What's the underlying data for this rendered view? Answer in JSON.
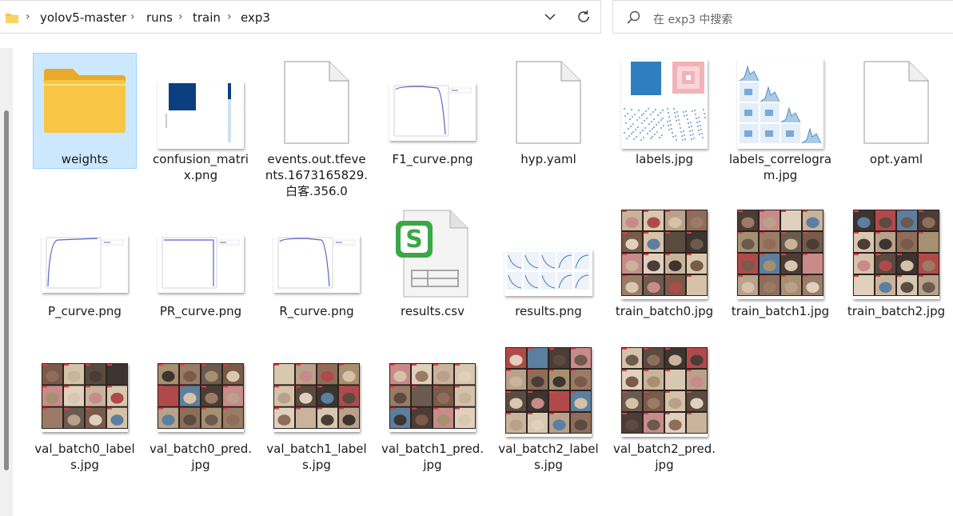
{
  "breadcrumb": [
    "yolov5-master",
    "runs",
    "train",
    "exp3"
  ],
  "search": {
    "placeholder": "在 exp3 中搜索"
  },
  "files": [
    {
      "name": "weights",
      "kind": "folder"
    },
    {
      "name": "confusion_matrix.png",
      "kind": "confusion"
    },
    {
      "name": "events.out.tfevents.1673165829.白客.356.0",
      "kind": "blank"
    },
    {
      "name": "F1_curve.png",
      "kind": "curve_drop"
    },
    {
      "name": "hyp.yaml",
      "kind": "blank"
    },
    {
      "name": "labels.jpg",
      "kind": "labels"
    },
    {
      "name": "labels_correlogram.jpg",
      "kind": "correlogram"
    },
    {
      "name": "opt.yaml",
      "kind": "blank"
    },
    {
      "name": "P_curve.png",
      "kind": "curve_rise"
    },
    {
      "name": "PR_curve.png",
      "kind": "curve_pr"
    },
    {
      "name": "R_curve.png",
      "kind": "curve_drop"
    },
    {
      "name": "results.csv",
      "kind": "csv"
    },
    {
      "name": "results.png",
      "kind": "results"
    },
    {
      "name": "train_batch0.jpg",
      "kind": "photo_tall"
    },
    {
      "name": "train_batch1.jpg",
      "kind": "photo_tall"
    },
    {
      "name": "train_batch2.jpg",
      "kind": "photo_tall"
    },
    {
      "name": "val_batch0_labels.jpg",
      "kind": "photo_wide"
    },
    {
      "name": "val_batch0_pred.jpg",
      "kind": "photo_wide"
    },
    {
      "name": "val_batch1_labels.jpg",
      "kind": "photo_wide"
    },
    {
      "name": "val_batch1_pred.jpg",
      "kind": "photo_wide"
    },
    {
      "name": "val_batch2_labels.jpg",
      "kind": "photo_tall"
    },
    {
      "name": "val_batch2_pred.jpg",
      "kind": "photo_tall"
    }
  ],
  "colors": {
    "selection": "#cce8ff",
    "folder": "#f8c544",
    "csv_green": "#3aa845"
  }
}
